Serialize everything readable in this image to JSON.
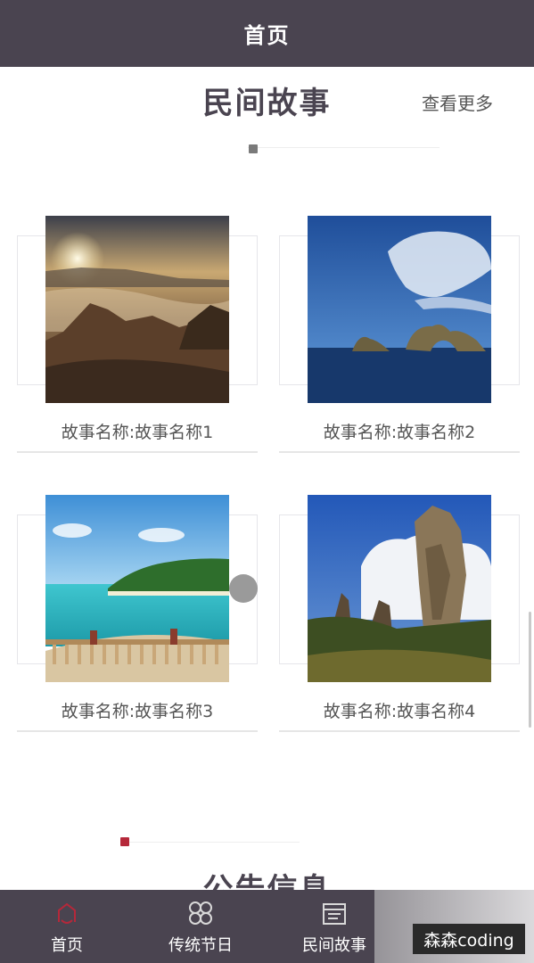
{
  "header": {
    "title": "首页"
  },
  "stories": {
    "title": "民间故事",
    "more_label": "查看更多",
    "items": [
      {
        "label": "故事名称:故事名称1",
        "image": "misty-mountain-sunrise"
      },
      {
        "label": "故事名称:故事名称2",
        "image": "sea-rock-arch"
      },
      {
        "label": "故事名称:故事名称3",
        "image": "tropical-beach-balcony"
      },
      {
        "label": "故事名称:故事名称4",
        "image": "stone-forest-sky"
      }
    ]
  },
  "notices": {
    "title": "公告信息"
  },
  "tabbar": {
    "items": [
      {
        "label": "首页",
        "icon": "home-icon",
        "active": true
      },
      {
        "label": "传统节日",
        "icon": "grid-icon",
        "active": false
      },
      {
        "label": "民间故事",
        "icon": "calendar-icon",
        "active": false
      }
    ]
  },
  "watermark": "森森coding",
  "colors": {
    "header_bg": "#4a4450",
    "active_tab": "#b5283a",
    "indicator_active": "#b5283a",
    "indicator_inactive": "#7a7a7a"
  }
}
